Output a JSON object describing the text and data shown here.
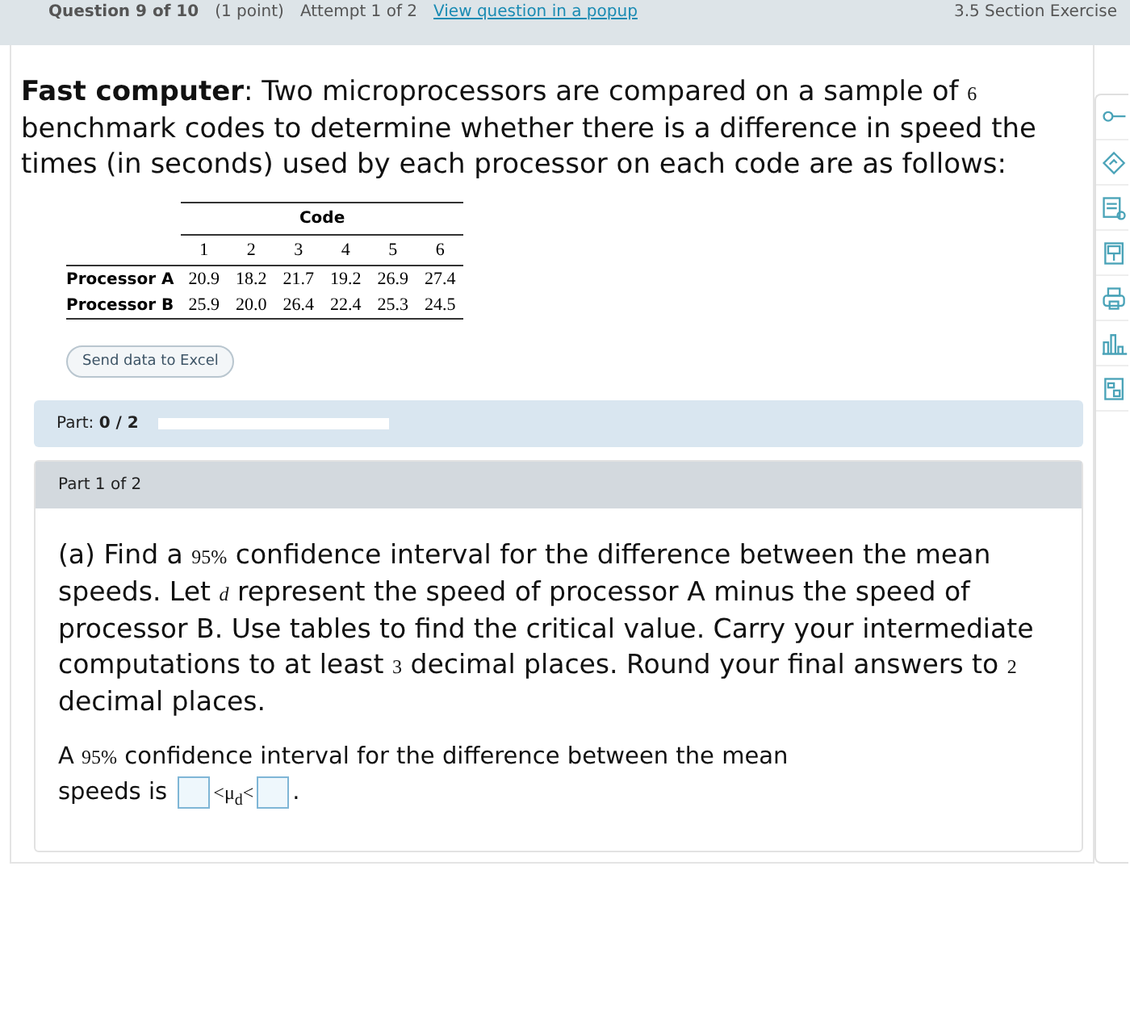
{
  "header": {
    "question": "Question 9 of 10",
    "points": "(1 point)",
    "attempt": "Attempt 1 of 2",
    "popup_link": "View question in a popup",
    "section": "3.5 Section Exercise"
  },
  "intro": [
    {
      "kind": "bold",
      "text": "Fast computer"
    },
    {
      "kind": "text",
      "text": ": Two microprocessors are compared on a sample of "
    },
    {
      "kind": "math",
      "text": "6"
    },
    {
      "kind": "text",
      "text": " benchmark codes to determine whether there is a difference in speed the times (in seconds) used by each processor on each code are as follows:"
    }
  ],
  "table": {
    "group_heading": "Code",
    "columns": [
      "1",
      "2",
      "3",
      "4",
      "5",
      "6"
    ],
    "rows": [
      {
        "label": "Processor A",
        "values": [
          "20.9",
          "18.2",
          "21.7",
          "19.2",
          "26.9",
          "27.4"
        ]
      },
      {
        "label": "Processor B",
        "values": [
          "25.9",
          "20.0",
          "26.4",
          "22.4",
          "25.3",
          "24.5"
        ]
      }
    ]
  },
  "excel_button": "Send data to Excel",
  "progress": {
    "label": "Part:",
    "score": "0 / 2",
    "level": 0
  },
  "part_heading": "Part 1 of 2",
  "question": [
    {
      "kind": "text",
      "text": "(a) Find a "
    },
    {
      "kind": "math",
      "text": "95%"
    },
    {
      "kind": "text",
      "text": " confidence interval for the difference between the mean speeds. Let "
    },
    {
      "kind": "math",
      "text": "*d*"
    },
    {
      "kind": "text",
      "text": " represent the speed of processor A minus the speed of processor B. Use tables to find the critical value. Carry your intermediate computations to at least "
    },
    {
      "kind": "math",
      "text": "3"
    },
    {
      "kind": "text",
      "text": " decimal places. Round your final answers to "
    },
    {
      "kind": "math",
      "text": "2"
    },
    {
      "kind": "text",
      "text": " decimal places."
    }
  ],
  "answer": {
    "before": [
      {
        "kind": "text",
        "text": "A "
      },
      {
        "kind": "math",
        "text": "95%"
      },
      {
        "kind": "text",
        "text": " confidence interval for the difference between the mean"
      }
    ],
    "lead": "speeds is",
    "middle": "<μ$_{d}$<",
    "after": "."
  }
}
